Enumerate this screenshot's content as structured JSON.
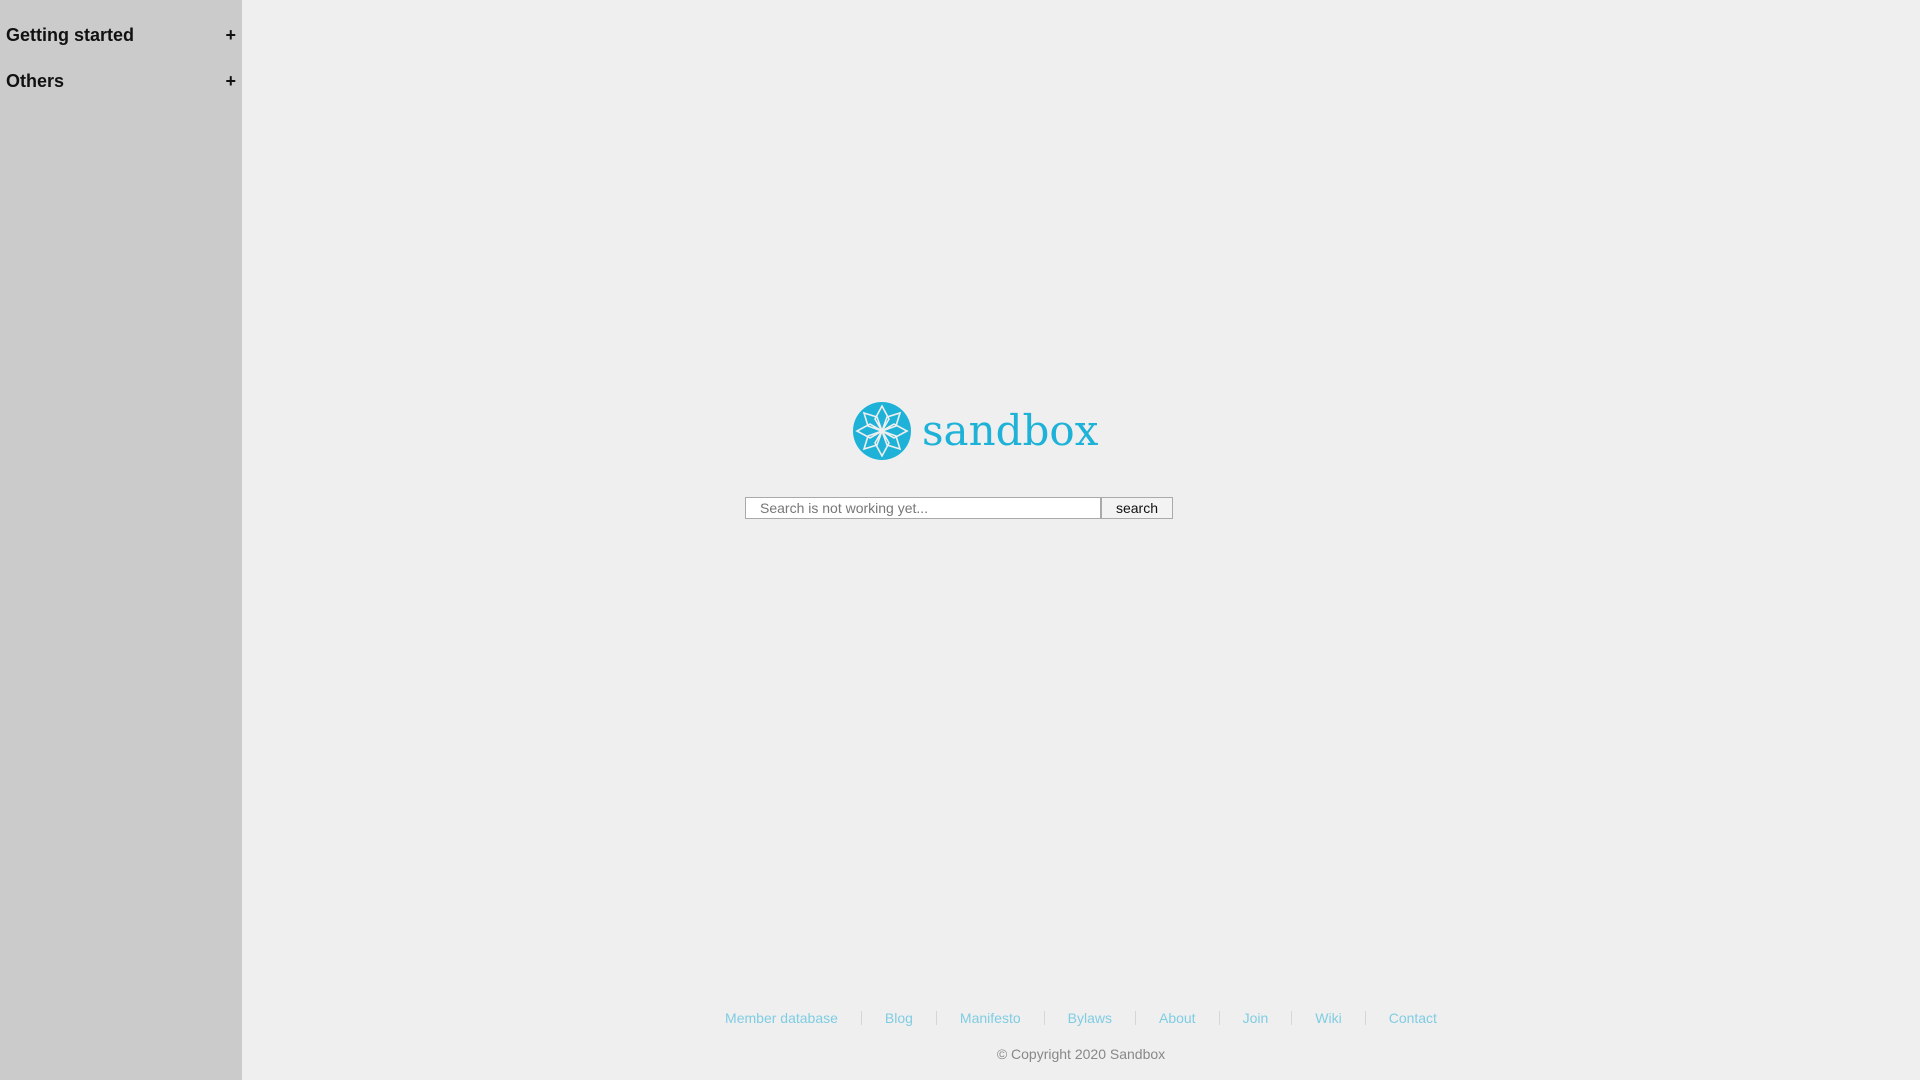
{
  "sidebar": {
    "items": [
      {
        "label": "Getting started",
        "toggle": "+"
      },
      {
        "label": "Others",
        "toggle": "+"
      }
    ]
  },
  "logo": {
    "text": "sandbox",
    "icon": "sandbox-flower-logo-icon",
    "color": "#1eb2d8"
  },
  "search": {
    "placeholder": "Search is not working yet...",
    "value": "",
    "button_label": "search"
  },
  "footer": {
    "links": {
      "member_database": "Member database",
      "blog": "Blog",
      "manifesto": "Manifesto",
      "bylaws": "Bylaws",
      "about": "About",
      "join": "Join",
      "wiki": "Wiki",
      "contact": "Contact"
    },
    "link_color": "#7fcde3",
    "copyright": "© Copyright 2020 Sandbox"
  },
  "colors": {
    "background": "#efefef",
    "sidebar": "#cbcbcb"
  }
}
